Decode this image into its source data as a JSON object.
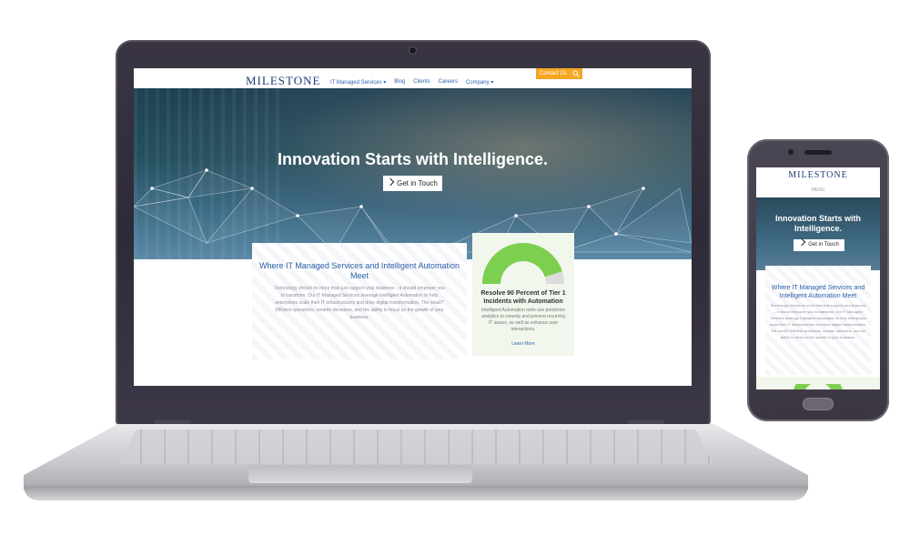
{
  "desktop": {
    "logo": "MILESTONE",
    "nav": [
      "IT Managed Services ▾",
      "Blog",
      "Clients",
      "Careers",
      "Company ▾"
    ],
    "contact_label": "Contact Us",
    "hero_title": "Innovation Starts with Intelligence.",
    "hero_button": "Get in Touch",
    "intro_heading": "Where IT Managed Services and Intelligent Automation Meet",
    "intro_text": "Technology should do more than just support your business – it should empower you to transform. Our IT Managed Services leverage Intelligent Automation to help enterprises scale their IT infrastructures and drive digital transformation. The result? Efficient operations, smarter decisions, and the ability to focus on the growth of your business.",
    "card_heading": "Resolve 90 Percent of Tier 1 Incidents with Automation",
    "card_text": "Intelligent Automation tools use predictive analytics to remedy and prevent recurring IT issues, as well as enhance user interactions.",
    "card_link": "Learn More",
    "gauge_fraction": 0.9,
    "colors": {
      "accent_orange": "#f5a623",
      "gauge_green": "#7dcf4f",
      "brand_blue": "#1f3b78",
      "link_blue": "#2f64b2"
    }
  },
  "mobile": {
    "logo": "MILESTONE",
    "menu_label": "MENU",
    "hero_title": "Innovation Starts with Intelligence.",
    "hero_button": "Get in Touch",
    "intro_heading": "Where IT Managed Services and Intelligent Automation Meet",
    "intro_text": "Technology should do more than just support your business – it should empower you to transform. Our IT Managed Services leverage Intelligent Automation to help enterprises scale their IT infrastructures and drive digital transformation. The result? Efficient operations, smarter decisions, and the ability to focus on the growth of your business."
  }
}
